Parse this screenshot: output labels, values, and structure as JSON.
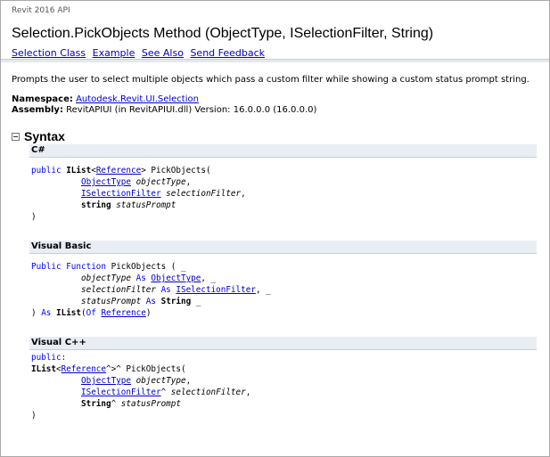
{
  "header": {
    "api_label": "Revit 2016 API",
    "title": "Selection.PickObjects Method (ObjectType, ISelectionFilter, String)",
    "links": {
      "selection_class": "Selection Class",
      "example": "Example",
      "see_also": "See Also",
      "send_feedback": "Send Feedback"
    }
  },
  "summary": "Prompts the user to select multiple objects which pass a custom filter while showing a custom status prompt string.",
  "namespace": {
    "label": "Namespace:",
    "value": "Autodesk.Revit.UI.Selection"
  },
  "assembly": {
    "label": "Assembly:",
    "value": "RevitAPIUI (in RevitAPIUI.dll) Version: 16.0.0.0 (16.0.0.0)"
  },
  "syntax": {
    "title": "Syntax",
    "csharp": {
      "label": "C#",
      "public": "public",
      "ilist": "IList",
      "reference": "Reference",
      "method": "PickObjects",
      "objecttype": "ObjectType",
      "p1": "objectType",
      "iselectionfilter": "ISelectionFilter",
      "p2": "selectionFilter",
      "string": "string",
      "p3": "statusPrompt"
    },
    "vb": {
      "label": "Visual Basic",
      "public": "Public",
      "function": "Function",
      "method": "PickObjects",
      "p1": "objectType",
      "as": "As",
      "objecttype": "ObjectType",
      "p2": "selectionFilter",
      "iselectionfilter": "ISelectionFilter",
      "p3": "statusPrompt",
      "string": "String",
      "ilist": "IList",
      "of": "Of",
      "reference": "Reference"
    },
    "cpp": {
      "label": "Visual C++",
      "public": "public:",
      "ilist": "IList",
      "reference": "Reference",
      "method": "PickObjects",
      "objecttype": "ObjectType",
      "p1": "objectType",
      "iselectionfilter": "ISelectionFilter",
      "p2": "selectionFilter",
      "string": "String",
      "p3": "statusPrompt"
    }
  },
  "colors": {
    "link": "#0000cc",
    "keyword": "#0000ff",
    "code_header_bg": "#e9edf4"
  },
  "icons": {
    "collapse": "collapse-minus-icon"
  }
}
